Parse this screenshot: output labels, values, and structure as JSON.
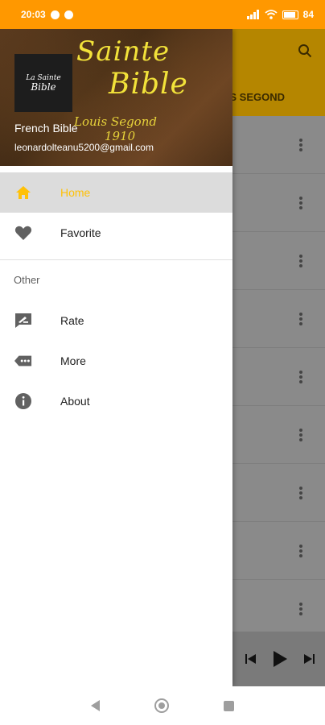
{
  "status_bar": {
    "time": "20:03",
    "battery": "84"
  },
  "background_app": {
    "tab_label": "S SEGOND"
  },
  "drawer": {
    "header": {
      "cover_line_1": "Sainte",
      "cover_line_2": "Bible",
      "cover_sub_1": "Louis Segond",
      "cover_sub_2": "1910",
      "logo_line_1": "La Sainte",
      "logo_line_2": "Bible",
      "app_name": "French Bible",
      "email": "leonardolteanu5200@gmail.com"
    },
    "menu": [
      {
        "label": "Home",
        "icon": "home-icon",
        "active": true
      },
      {
        "label": "Favorite",
        "icon": "heart-icon",
        "active": false
      }
    ],
    "other_section": {
      "title": "Other",
      "items": [
        {
          "label": "Rate",
          "icon": "rate-icon"
        },
        {
          "label": "More",
          "icon": "more-icon"
        },
        {
          "label": "About",
          "icon": "info-icon"
        }
      ]
    }
  },
  "colors": {
    "status_bar": "#ff9800",
    "accent": "#ffc107",
    "active_row": "#dcdcdc",
    "toolbar_dim": "#b58600"
  }
}
